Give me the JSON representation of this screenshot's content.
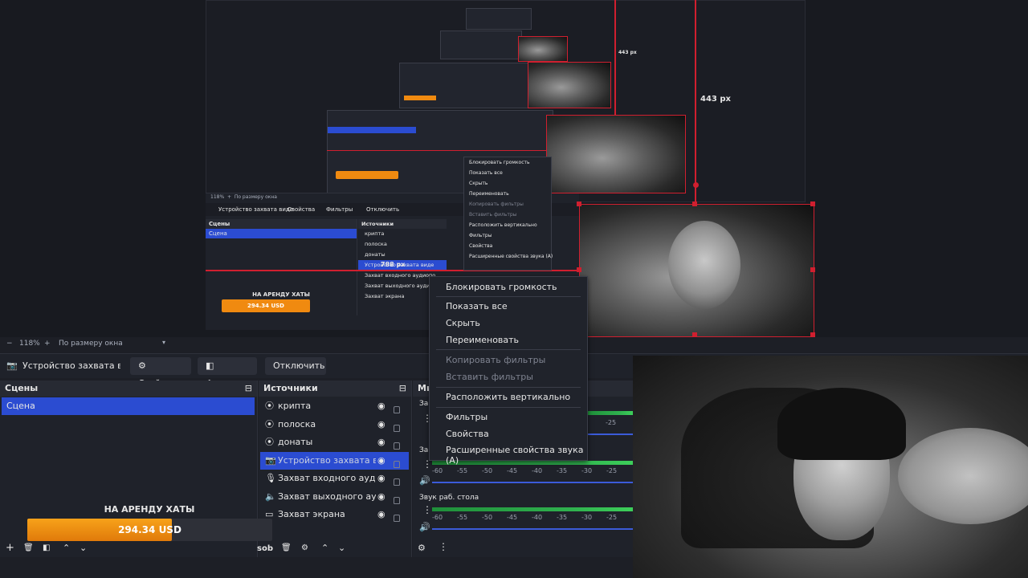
{
  "preview": {
    "dimension_vertical": "443 px",
    "dimension_vertical_small": "443 px",
    "dimension_horizontal": "788 px",
    "mini_donation_title": "НА АРЕНДУ ХАТЫ",
    "mini_donation_amount": "294.34 USD",
    "mini_scene_name": "Сцена",
    "mini_source_label": "Устройство захвата виде",
    "mini_props": "Свойства",
    "mini_filters": "Фильтры",
    "mini_disconnect": "Отключить",
    "mini_zoom": "118%",
    "mini_fit": "По размеру окна",
    "mini_sources": [
      "крипта",
      "полоска",
      "донаты",
      "Устройство захвата виде",
      "Захват входного аудиопо",
      "Захват выходного аудиоп",
      "Захват экрана"
    ],
    "mini_menu": [
      "Блокировать громкость",
      "Показать все",
      "Скрыть",
      "Переименовать",
      "Копировать фильтры",
      "Вставить фильтры",
      "Расположить вертикально",
      "Фильтры",
      "Свойства",
      "Расширенные свойства звука (А)"
    ]
  },
  "zoom_bar": {
    "minus": "−",
    "zoom": "118%",
    "plus": "+",
    "fit": "По размеру окна"
  },
  "source_toolbar": {
    "source_name": "Устройство захвата виде",
    "properties": "Свойства",
    "filters": "Фильтры",
    "disconnect": "Отключить"
  },
  "scenes": {
    "title": "Сцены",
    "items": [
      "Сцена"
    ]
  },
  "sources": {
    "title": "Источники",
    "items": [
      {
        "label": "крипта",
        "icon": "scene-icon"
      },
      {
        "label": "полоска",
        "icon": "scene-icon"
      },
      {
        "label": "донаты",
        "icon": "scene-icon"
      },
      {
        "label": "Устройство захвата виде",
        "icon": "camera-icon",
        "selected": true
      },
      {
        "label": "Захват входного аудиопс",
        "icon": "mic-icon"
      },
      {
        "label": "Захват выходного аудиог",
        "icon": "speaker-icon"
      },
      {
        "label": "Захват экрана",
        "icon": "monitor-icon"
      }
    ],
    "bottom_label": "sob"
  },
  "mixer": {
    "title": "Ми",
    "tracks": [
      {
        "label": "За",
        "level": 0.9
      },
      {
        "label": "За",
        "level": 0.9
      },
      {
        "label": "Звук раб. стола",
        "level": 0.9
      }
    ],
    "ticks": [
      "-60",
      "-55",
      "-50",
      "-45",
      "-40",
      "-35",
      "-30",
      "-25"
    ]
  },
  "context_menu": {
    "items": [
      {
        "label": "Блокировать громкость",
        "enabled": true
      },
      {
        "label": "Показать все",
        "enabled": true
      },
      {
        "label": "Скрыть",
        "enabled": true
      },
      {
        "label": "Переименовать",
        "enabled": true
      },
      {
        "label": "Копировать фильтры",
        "enabled": false
      },
      {
        "label": "Вставить фильтры",
        "enabled": false
      },
      {
        "label": "Расположить вертикально",
        "enabled": true
      },
      {
        "label": "Фильтры",
        "enabled": true
      },
      {
        "label": "Свойства",
        "enabled": true
      },
      {
        "label": "Расширенные свойства звука (А)",
        "enabled": true
      }
    ]
  },
  "donation": {
    "title": "НА АРЕНДУ ХАТЫ",
    "amount": "294.34 USD",
    "progress": 0.59
  },
  "colors": {
    "accent": "#2b4cd1",
    "selection_red": "#d01f2f",
    "donation_orange": "#f08a10",
    "meter_green": "#2fb14e"
  }
}
